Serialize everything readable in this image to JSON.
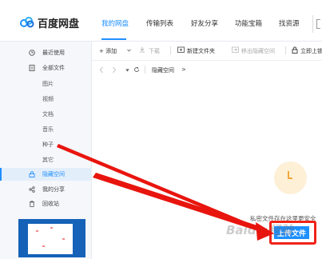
{
  "app": {
    "name": "百度网盘"
  },
  "header": {
    "nav": [
      {
        "label": "我的网盘",
        "active": true
      },
      {
        "label": "传输列表"
      },
      {
        "label": "好友分享"
      },
      {
        "label": "功能宝箱"
      },
      {
        "label": "找资源"
      }
    ]
  },
  "sidebar": {
    "items": [
      {
        "label": "最近使用",
        "icon": "clock-icon"
      },
      {
        "label": "全部文件",
        "icon": "file-icon"
      },
      {
        "label": "隐藏空间",
        "icon": "lock-icon",
        "active": true
      },
      {
        "label": "我的分享",
        "icon": "share-icon"
      },
      {
        "label": "回收站",
        "icon": "trash-icon"
      }
    ],
    "subitems": [
      "图片",
      "视频",
      "文档",
      "音乐",
      "种子",
      "其它"
    ]
  },
  "toolbar": {
    "add": "+ 添加",
    "download": "下载",
    "new_folder": "新建文件夹",
    "move_out": "移出隐藏空间",
    "lock": "立即上锁"
  },
  "pathbar": {
    "current": "隐藏空间",
    "separator": ">"
  },
  "empty_state": {
    "message": "私密文件存在这里更安全",
    "button": "上传文件"
  },
  "annotation": {
    "highlight_color": "#f0231a",
    "arrow_color": "#e8150e"
  },
  "watermark": "Baidu 经验",
  "colors": {
    "accent": "#1e8fff",
    "sidebar_bg": "#f5f7fa",
    "active_bg": "#e3eefb"
  }
}
